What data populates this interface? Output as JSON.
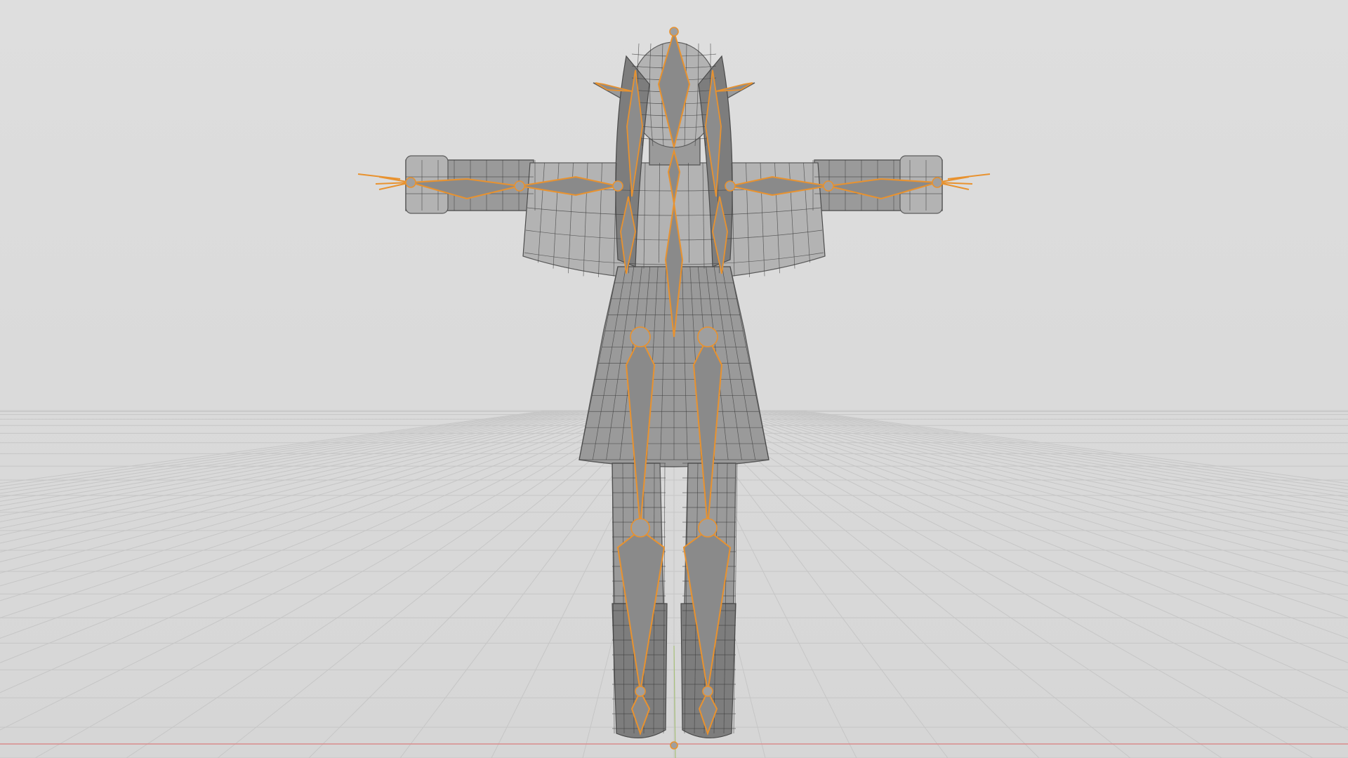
{
  "viewport": {
    "background_color": "#dcdcdc",
    "grid_color": "#c6c6c6",
    "x_axis_color": "#d98b8b",
    "y_axis_color": "#a7c07a",
    "selection_color": "#e8922f"
  },
  "scene": {
    "object": "armature-with-character-mesh",
    "pose": "t-pose",
    "view": "front"
  }
}
